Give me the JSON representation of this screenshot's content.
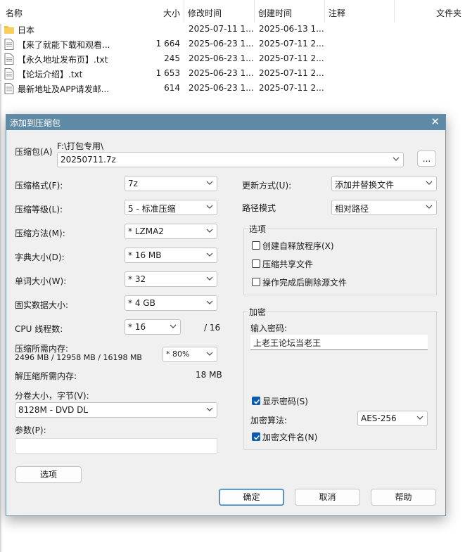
{
  "file_list": {
    "columns": {
      "name": "名称",
      "size": "大小",
      "modified": "修改时间",
      "created": "创建时间",
      "comment": "注释",
      "folder": "文件夹"
    },
    "rows": [
      {
        "icon": "folder-icon",
        "name": "日本",
        "size": "",
        "modified": "2025-07-11 1...",
        "created": "2025-06-13 1..."
      },
      {
        "icon": "text-file-icon",
        "name": "【来了就能下载和观看...",
        "size": "1 664",
        "modified": "2025-06-23 1...",
        "created": "2025-07-11 2..."
      },
      {
        "icon": "text-file-icon",
        "name": "【永久地址发布页】.txt",
        "size": "245",
        "modified": "2025-06-23 1...",
        "created": "2025-07-11 2..."
      },
      {
        "icon": "text-file-icon",
        "name": "【论坛介绍】.txt",
        "size": "1 653",
        "modified": "2025-06-23 1...",
        "created": "2025-07-11 2..."
      },
      {
        "icon": "text-file-icon",
        "name": "最新地址及APP请发邮...",
        "size": "614",
        "modified": "2025-06-23 1...",
        "created": "2025-07-11 2..."
      }
    ]
  },
  "dialog": {
    "title": "添加到压缩包",
    "close_icon": "close-icon",
    "archive_label": "压缩包(A)",
    "archive_path": "F:\\打包专用\\",
    "archive_name": "20250711.7z",
    "browse_label": "...",
    "format_label": "压缩格式(F):",
    "format_value": "7z",
    "level_label": "压缩等级(L):",
    "level_value": "5 - 标准压缩",
    "method_label": "压缩方法(M):",
    "method_value": "*  LZMA2",
    "dict_label": "字典大小(D):",
    "dict_value": "*  16 MB",
    "word_label": "单词大小(W):",
    "word_value": "*  32",
    "solid_label": "固实数据大小:",
    "solid_value": "*  4 GB",
    "cpu_label": "CPU 线程数:",
    "cpu_value": "*  16",
    "cpu_total": "/ 16",
    "mem_label": "压缩所需内存:",
    "mem_detail": "2496 MB / 12958 MB / 16198 MB",
    "mem_value": "*  80%",
    "decomp_label": "解压缩所需内存:",
    "decomp_value": "18 MB",
    "volume_label": "分卷大小，字节(V):",
    "volume_value": "8128M - DVD DL",
    "params_label": "参数(P):",
    "params_value": "",
    "options_button": "选项",
    "update_label": "更新方式(U):",
    "update_value": "添加并替换文件",
    "path_label": "路径模式",
    "path_value": "相对路径",
    "options_group": "选项",
    "opt_sfx": "创建自释放程序(X)",
    "opt_shared": "压缩共享文件",
    "opt_delete": "操作完成后删除源文件",
    "opt_sfx_checked": false,
    "opt_shared_checked": false,
    "opt_delete_checked": false,
    "encrypt_group": "加密",
    "password_label": "输入密码:",
    "password_value": "上老王论坛当老王",
    "show_password": "显示密码(S)",
    "show_password_checked": true,
    "enc_method_label": "加密算法:",
    "enc_method_value": "AES-256",
    "encrypt_names": "加密文件名(N)",
    "encrypt_names_checked": true,
    "ok_button": "确定",
    "cancel_button": "取消",
    "help_button": "帮助"
  },
  "colors": {
    "titlebar": "#5e8aa6",
    "checkbox_checked": "#0b5cad",
    "folder": "#f4c342"
  }
}
